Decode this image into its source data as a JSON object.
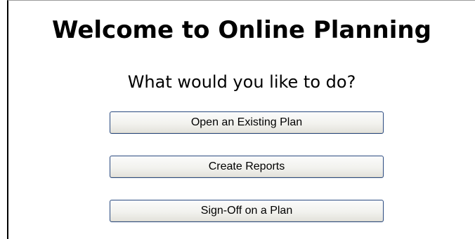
{
  "page": {
    "title": "Welcome to Online Planning",
    "prompt": "What would you like to do?"
  },
  "actions": [
    {
      "label": "Open an Existing Plan"
    },
    {
      "label": "Create Reports"
    },
    {
      "label": "Sign-Off on a Plan"
    }
  ],
  "colors": {
    "button_border": "#2a4a80",
    "panel_left_border": "#000000"
  }
}
